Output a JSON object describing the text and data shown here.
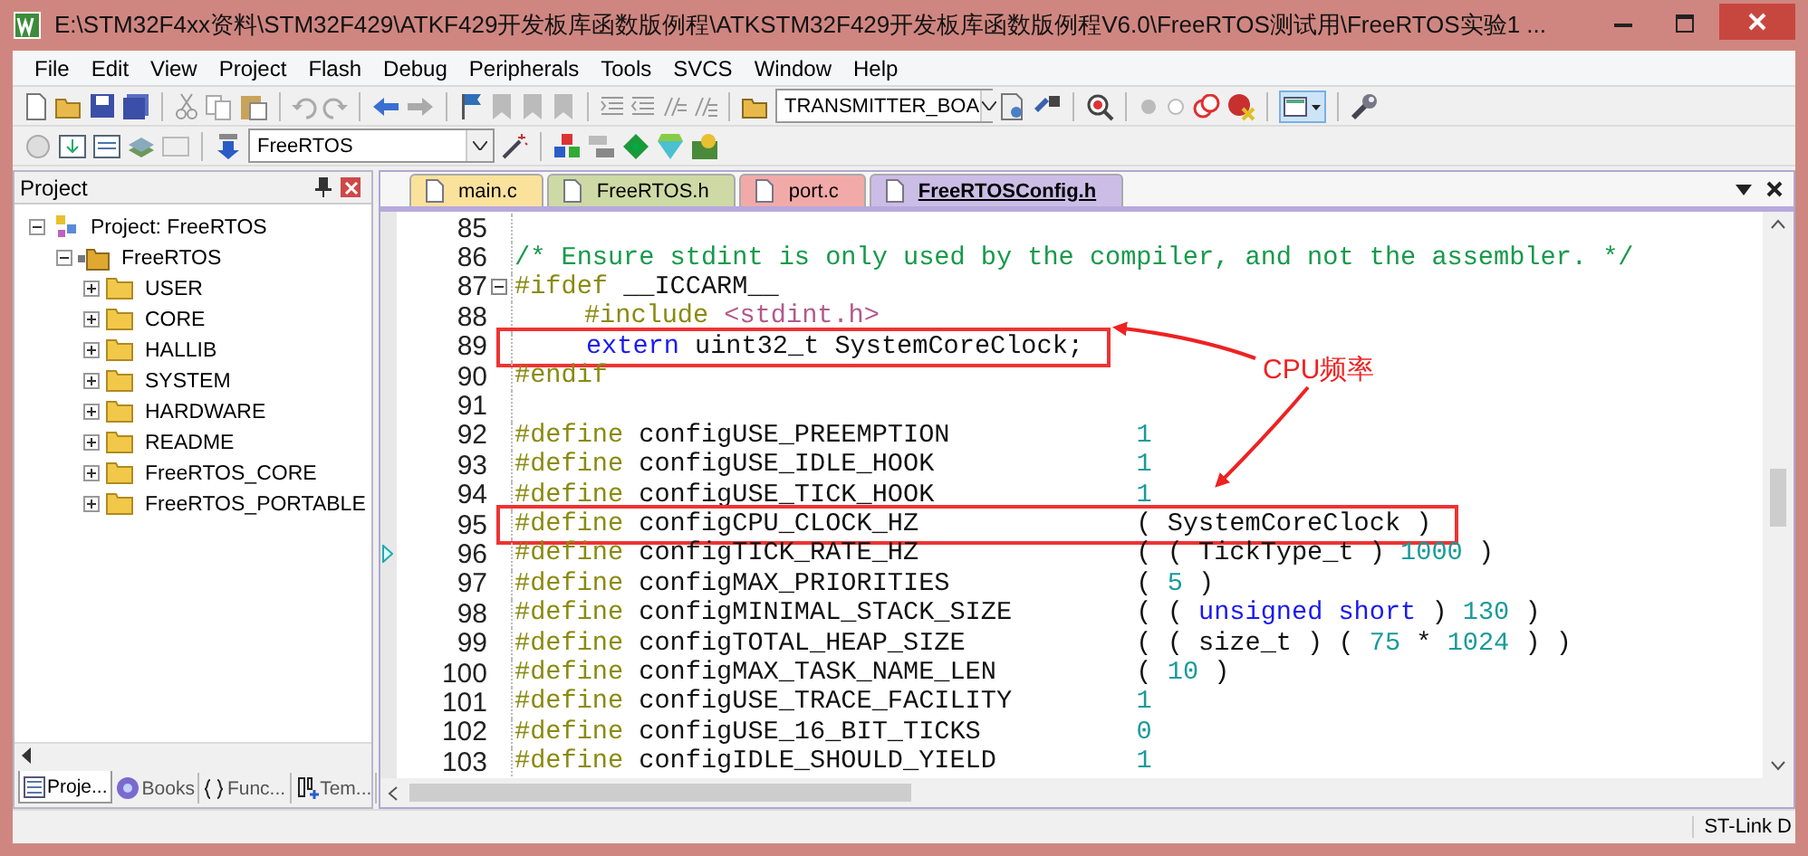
{
  "window": {
    "title": "E:\\STM32F4xx资料\\STM32F429\\ATKF429开发板库函数版例程\\ATKSTM32F429开发板库函数版例程V6.0\\FreeRTOS测试用\\FreeRTOS实验1 ..."
  },
  "menu": [
    "File",
    "Edit",
    "View",
    "Project",
    "Flash",
    "Debug",
    "Peripherals",
    "Tools",
    "SVCS",
    "Window",
    "Help"
  ],
  "toolbar": {
    "target": "TRANSMITTER_BOA",
    "project_target": "FreeRTOS"
  },
  "project_pane": {
    "title": "Project",
    "tree": [
      {
        "label": "Project: FreeRTOS",
        "kind": "project",
        "expanded": true,
        "children": [
          {
            "label": "FreeRTOS",
            "kind": "target",
            "expanded": true,
            "children": [
              {
                "label": "USER",
                "kind": "group",
                "expanded": false
              },
              {
                "label": "CORE",
                "kind": "group",
                "expanded": false
              },
              {
                "label": "HALLIB",
                "kind": "group",
                "expanded": false
              },
              {
                "label": "SYSTEM",
                "kind": "group",
                "expanded": false
              },
              {
                "label": "HARDWARE",
                "kind": "group",
                "expanded": false
              },
              {
                "label": "README",
                "kind": "group",
                "expanded": false
              },
              {
                "label": "FreeRTOS_CORE",
                "kind": "group",
                "expanded": false
              },
              {
                "label": "FreeRTOS_PORTABLE",
                "kind": "group",
                "expanded": false
              }
            ]
          }
        ]
      }
    ],
    "tabs": [
      {
        "label": "Proje...",
        "kind": "project",
        "selected": true
      },
      {
        "label": "Books",
        "kind": "books",
        "selected": false
      },
      {
        "label": "Func...",
        "kind": "functions",
        "selected": false
      },
      {
        "label": "Tem...",
        "kind": "templates",
        "selected": false
      }
    ]
  },
  "editor": {
    "tabs": [
      {
        "label": "main.c",
        "color": "#fbe29c",
        "selected": false
      },
      {
        "label": "FreeRTOS.h",
        "color": "#cddaa5",
        "selected": false
      },
      {
        "label": "port.c",
        "color": "#f2aaa8",
        "selected": false
      },
      {
        "label": "FreeRTOSConfig.h",
        "color": "#cbbde6",
        "selected": true
      }
    ],
    "lines": [
      {
        "number": "85"
      },
      {
        "number": "86",
        "tokens": [
          {
            "kind": "comment",
            "text": "/* Ensure stdint is only used by the compiler, and not the assembler. */"
          }
        ]
      },
      {
        "number": "87",
        "fold": true,
        "tokens": [
          {
            "kind": "preprocessor",
            "text": "#ifdef"
          },
          {
            "kind": "plain",
            "text": " __ICCARM__"
          }
        ]
      },
      {
        "number": "88",
        "indented": true,
        "tokens": [
          {
            "kind": "preprocessor",
            "text": "#include"
          },
          {
            "kind": "string",
            "text": " <stdint.h>"
          }
        ]
      },
      {
        "number": "89",
        "boxed": true,
        "indented": true,
        "tokens": [
          {
            "kind": "keyword",
            "text": "extern"
          },
          {
            "kind": "plain",
            "text": " uint32_t SystemCoreClock;"
          }
        ]
      },
      {
        "number": "90",
        "tokens": [
          {
            "kind": "preprocessor",
            "text": "#endif"
          }
        ]
      },
      {
        "number": "91"
      },
      {
        "number": "92",
        "tokens": [
          {
            "kind": "preprocessor",
            "text": "#define"
          },
          {
            "kind": "plain",
            "text": " configUSE_PREEMPTION            "
          },
          {
            "kind": "number",
            "text": "1"
          }
        ]
      },
      {
        "number": "93",
        "tokens": [
          {
            "kind": "preprocessor",
            "text": "#define"
          },
          {
            "kind": "plain",
            "text": " configUSE_IDLE_HOOK             "
          },
          {
            "kind": "number",
            "text": "1"
          }
        ]
      },
      {
        "number": "94",
        "tokens": [
          {
            "kind": "preprocessor",
            "text": "#define"
          },
          {
            "kind": "plain",
            "text": " configUSE_TICK_HOOK             "
          },
          {
            "kind": "number",
            "text": "1"
          }
        ]
      },
      {
        "number": "95",
        "boxed": true,
        "tokens": [
          {
            "kind": "preprocessor",
            "text": "#define"
          },
          {
            "kind": "plain",
            "text": " configCPU_CLOCK_HZ              ( SystemCoreClock )"
          }
        ]
      },
      {
        "number": "96",
        "current": true,
        "tokens": [
          {
            "kind": "preprocessor",
            "text": "#define"
          },
          {
            "kind": "plain",
            "text": " configTICK_RATE_HZ              ( ( TickType_t ) "
          },
          {
            "kind": "number",
            "text": "1000"
          },
          {
            "kind": "plain",
            "text": " )"
          }
        ]
      },
      {
        "number": "97",
        "tokens": [
          {
            "kind": "preprocessor",
            "text": "#define"
          },
          {
            "kind": "plain",
            "text": " configMAX_PRIORITIES            ( "
          },
          {
            "kind": "number",
            "text": "5"
          },
          {
            "kind": "plain",
            "text": " )"
          }
        ]
      },
      {
        "number": "98",
        "tokens": [
          {
            "kind": "preprocessor",
            "text": "#define"
          },
          {
            "kind": "plain",
            "text": " configMINIMAL_STACK_SIZE        ( ( "
          },
          {
            "kind": "keyword",
            "text": "unsigned short"
          },
          {
            "kind": "plain",
            "text": " ) "
          },
          {
            "kind": "number",
            "text": "130"
          },
          {
            "kind": "plain",
            "text": " )"
          }
        ]
      },
      {
        "number": "99",
        "tokens": [
          {
            "kind": "preprocessor",
            "text": "#define"
          },
          {
            "kind": "plain",
            "text": " configTOTAL_HEAP_SIZE           ( ( size_t ) ( "
          },
          {
            "kind": "number",
            "text": "75"
          },
          {
            "kind": "plain",
            "text": " * "
          },
          {
            "kind": "number",
            "text": "1024"
          },
          {
            "kind": "plain",
            "text": " ) )"
          }
        ]
      },
      {
        "number": "100",
        "tokens": [
          {
            "kind": "preprocessor",
            "text": "#define"
          },
          {
            "kind": "plain",
            "text": " configMAX_TASK_NAME_LEN         ( "
          },
          {
            "kind": "number",
            "text": "10"
          },
          {
            "kind": "plain",
            "text": " )"
          }
        ]
      },
      {
        "number": "101",
        "tokens": [
          {
            "kind": "preprocessor",
            "text": "#define"
          },
          {
            "kind": "plain",
            "text": " configUSE_TRACE_FACILITY        "
          },
          {
            "kind": "number",
            "text": "1"
          }
        ]
      },
      {
        "number": "102",
        "tokens": [
          {
            "kind": "preprocessor",
            "text": "#define"
          },
          {
            "kind": "plain",
            "text": " configUSE_16_BIT_TICKS          "
          },
          {
            "kind": "number",
            "text": "0"
          }
        ]
      },
      {
        "number": "103",
        "tokens": [
          {
            "kind": "preprocessor",
            "text": "#define"
          },
          {
            "kind": "plain",
            "text": " configIDLE_SHOULD_YIELD         "
          },
          {
            "kind": "number",
            "text": "1"
          }
        ]
      }
    ]
  },
  "annotation": {
    "label": "CPU频率"
  },
  "status_bar": {
    "debugger": "ST-Link D"
  }
}
